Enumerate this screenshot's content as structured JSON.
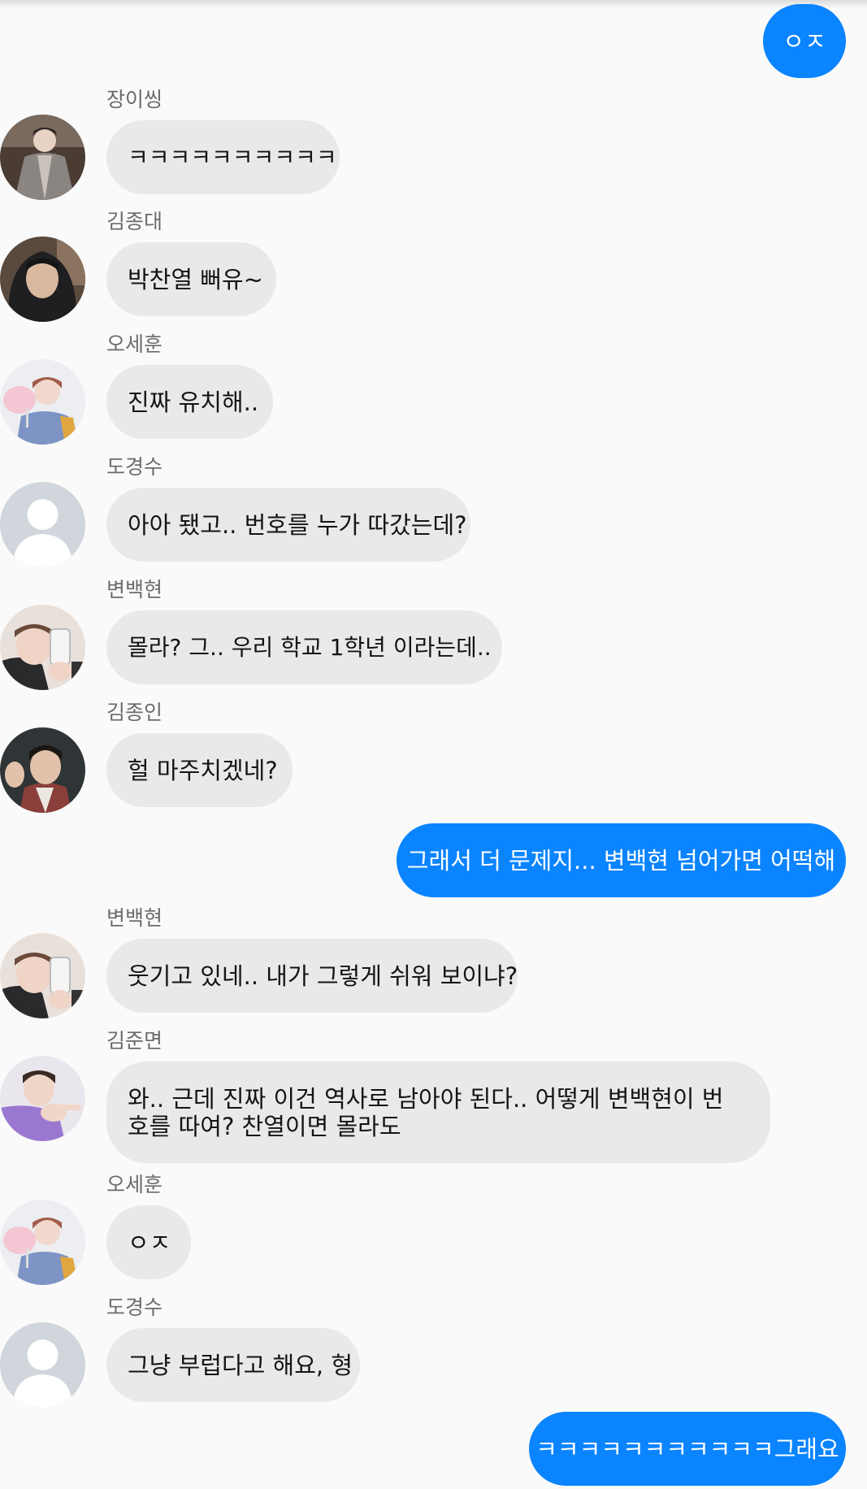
{
  "messages": [
    {
      "sender": "",
      "text": "ㅇㅈ",
      "outgoing": true
    },
    {
      "sender": "장이씽",
      "text": "ㅋㅋㅋㅋㅋㅋㅋㅋㅋㅋ",
      "outgoing": false,
      "avatar": "photo-brown-coat"
    },
    {
      "sender": "김종대",
      "text": "박찬열 뻐유~",
      "outgoing": false,
      "avatar": "photo-dark-hood"
    },
    {
      "sender": "오세훈",
      "text": "진짜 유치해..",
      "outgoing": false,
      "avatar": "photo-cotton-candy"
    },
    {
      "sender": "도경수",
      "text": "아아 됐고.. 번호를 누가 따갔는데?",
      "outgoing": false,
      "avatar": "default-silhouette"
    },
    {
      "sender": "변백현",
      "text": "몰라? 그.. 우리 학교 1학년 이라는데..",
      "outgoing": false,
      "avatar": "photo-phone-selfie"
    },
    {
      "sender": "김종인",
      "text": "헐 마주치겠네?",
      "outgoing": false,
      "avatar": "photo-waving"
    },
    {
      "sender": "",
      "text": "그래서 더 문제지... 변백현 넘어가면 어떡해",
      "outgoing": true
    },
    {
      "sender": "변백현",
      "text": "웃기고 있네.. 내가 그렇게 쉬워 보이냐?",
      "outgoing": false,
      "avatar": "photo-phone-selfie"
    },
    {
      "sender": "김준면",
      "text": "와.. 근데 진짜 이건 역사로 남아야 된다.. 어떻게 변백현이 번호를 따여? 찬열이면 몰라도",
      "outgoing": false,
      "avatar": "photo-purple-pointing"
    },
    {
      "sender": "오세훈",
      "text": "ㅇㅈ",
      "outgoing": false,
      "avatar": "photo-cotton-candy"
    },
    {
      "sender": "도경수",
      "text": "그냥 부럽다고 해요, 형",
      "outgoing": false,
      "avatar": "default-silhouette"
    },
    {
      "sender": "",
      "text": "ㅋㅋㅋㅋㅋㅋㅋㅋㅋㅋㅋ그래요",
      "outgoing": true
    }
  ],
  "colors": {
    "background": "#fafafa",
    "incoming_bubble": "#e9e9e9",
    "outgoing_bubble": "#0a84ff",
    "sender_name": "#6b6b6b"
  }
}
